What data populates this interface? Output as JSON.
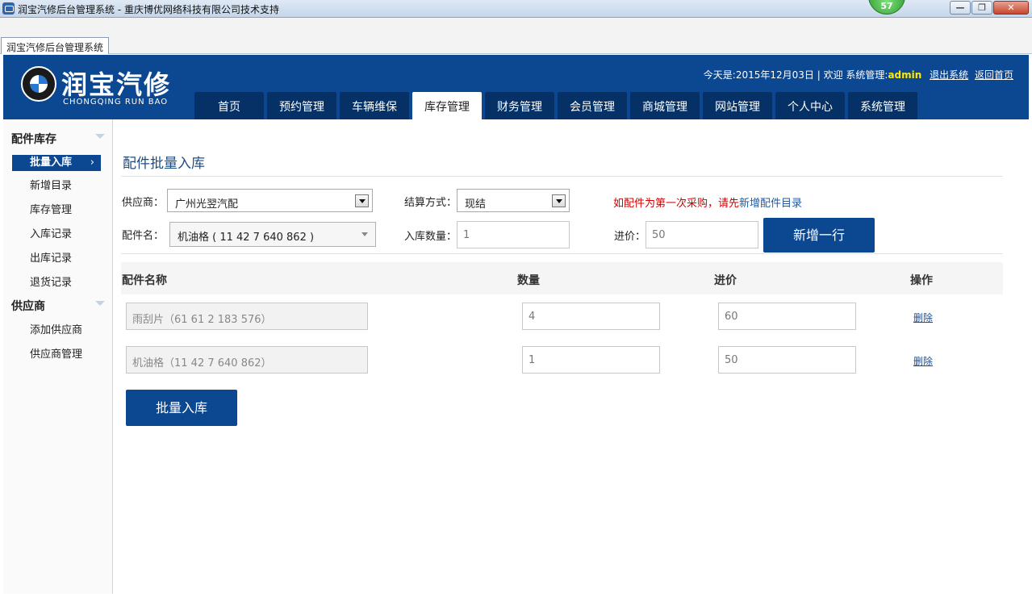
{
  "window": {
    "title": "润宝汽修后台管理系统 - 重庆博优网络科技有限公司技术支持",
    "badge_count": "57",
    "min_glyph": "—",
    "max_glyph": "❐",
    "close_glyph": "✕"
  },
  "doc_tab": {
    "label": "润宝汽修后台管理系统"
  },
  "header": {
    "logo_text": "润宝汽修",
    "logo_sub": "CHONGQING RUN BAO",
    "today_label": "今天是:2015年12月03日 | 欢迎 系统管理:",
    "user": "admin",
    "logout": "退出系统",
    "home_link": "返回首页"
  },
  "nav": {
    "items": [
      {
        "label": "首页"
      },
      {
        "label": "预约管理"
      },
      {
        "label": "车辆维保"
      },
      {
        "label": "库存管理"
      },
      {
        "label": "财务管理"
      },
      {
        "label": "会员管理"
      },
      {
        "label": "商城管理"
      },
      {
        "label": "网站管理"
      },
      {
        "label": "个人中心"
      },
      {
        "label": "系统管理"
      }
    ],
    "active": "库存管理"
  },
  "sidebar": {
    "group1": "配件库存",
    "items1": [
      {
        "label": "批量入库"
      },
      {
        "label": "新增目录"
      },
      {
        "label": "库存管理"
      },
      {
        "label": "入库记录"
      },
      {
        "label": "出库记录"
      },
      {
        "label": "退货记录"
      }
    ],
    "active_arrow": "›",
    "group2": "供应商",
    "items2": [
      {
        "label": "添加供应商"
      },
      {
        "label": "供应商管理"
      }
    ]
  },
  "form": {
    "page_title": "配件批量入库",
    "supplier_label": "供应商：",
    "supplier_value": "广州光翌汽配",
    "settle_label": "结算方式：",
    "settle_value": "现结",
    "hint_text": "如配件为第一次采购，请先",
    "hint_link": "新增配件目录",
    "part_label": "配件名：",
    "part_value": "机油格 ( 11 42 7 640 862 )",
    "qty_label": "入库数量：",
    "qty_value": "1",
    "price_label": "进价：",
    "price_value": "50",
    "add_row_button": "新增一行"
  },
  "table": {
    "headers": {
      "name": "配件名称",
      "qty": "数量",
      "price": "进价",
      "op": "操作"
    },
    "rows": [
      {
        "name": "雨刮片（61 61 2 183 576）",
        "qty": "4",
        "price": "60",
        "op": "删除"
      },
      {
        "name": "机油格（11 42 7 640 862）",
        "qty": "1",
        "price": "50",
        "op": "删除"
      }
    ]
  },
  "submit_button": "批量入库",
  "colors": {
    "primary": "#0c4792",
    "nav_dark": "#053166",
    "hint_red": "#d40000",
    "admin_yellow": "#ffea00"
  }
}
